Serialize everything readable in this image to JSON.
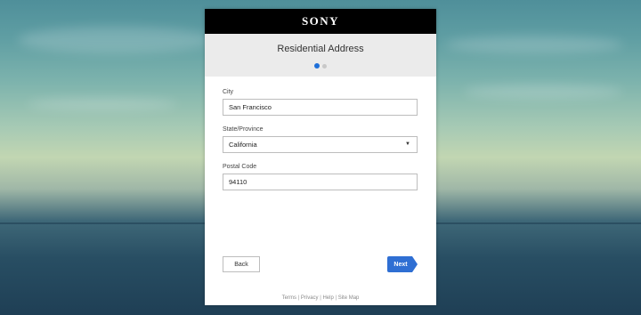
{
  "brand": "SONY",
  "page": {
    "title": "Residential Address",
    "steps_total": 2,
    "current_step": 1
  },
  "form": {
    "city": {
      "label": "City",
      "value": "San Francisco"
    },
    "state": {
      "label": "State/Province",
      "value": "California"
    },
    "postal": {
      "label": "Postal Code",
      "value": "94110"
    }
  },
  "actions": {
    "back_label": "Back",
    "next_label": "Next"
  },
  "footer": {
    "links": [
      "Terms",
      "Privacy",
      "Help",
      "Site Map"
    ],
    "separator": " | "
  },
  "colors": {
    "accent": "#1e6fd9",
    "next_button": "#2f6fd3",
    "brand_bar": "#000000"
  },
  "icons": {
    "select_caret": "caret-down-icon"
  }
}
